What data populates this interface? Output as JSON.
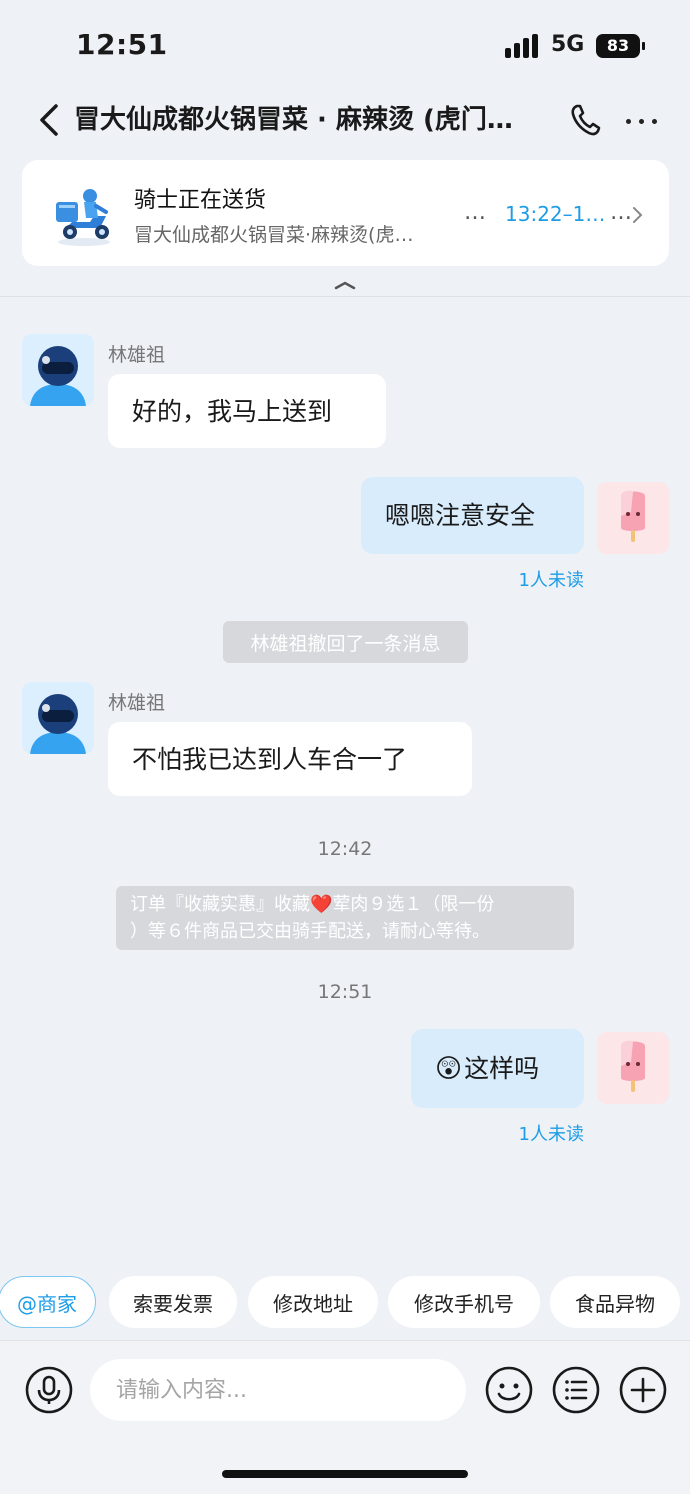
{
  "status_bar": {
    "time": "12:51",
    "network": "5G",
    "battery": "83"
  },
  "nav": {
    "title": "冒大仙成都火锅冒菜 · 麻辣烫 (虎门…"
  },
  "delivery_card": {
    "title": "骑士正在送货",
    "subtitle": "冒大仙成都火锅冒菜·麻辣烫(虎…",
    "dots_left": "…",
    "eta": "13:22–1…",
    "dots_right": "…"
  },
  "messages": [
    {
      "sender": "林雄祖",
      "text": "好的，我马上送到"
    },
    {
      "text": "嗯嗯注意安全",
      "status": "1人未读"
    },
    {
      "system": "林雄祖撤回了一条消息"
    },
    {
      "sender": "林雄祖",
      "text": "不怕我已达到人车合一了"
    },
    {
      "timestamp": "12:42"
    },
    {
      "notice_line1": "订单『收藏实惠』收藏❤️荤肉９选１（限一份",
      "notice_line2": "）等６件商品已交由骑手配送，请耐心等待。"
    },
    {
      "timestamp": "12:51"
    },
    {
      "emoji": "😲",
      "text": "这样吗",
      "status": "1人未读"
    }
  ],
  "quick_actions": [
    "@商家",
    "索要发票",
    "修改地址",
    "修改手机号",
    "食品异物"
  ],
  "input": {
    "placeholder": "请输入内容..."
  },
  "icons": {
    "back": "chevron-left-icon",
    "phone": "phone-icon",
    "more": "more-icon",
    "voice": "microphone-icon",
    "emoji": "smiley-icon",
    "menu": "list-icon",
    "plus": "plus-icon"
  },
  "colors": {
    "accent": "#1e9de6",
    "outgoing_bubble": "#d9ecfb",
    "background": "#eef1f6",
    "system_pill": "#d6d8dc"
  }
}
